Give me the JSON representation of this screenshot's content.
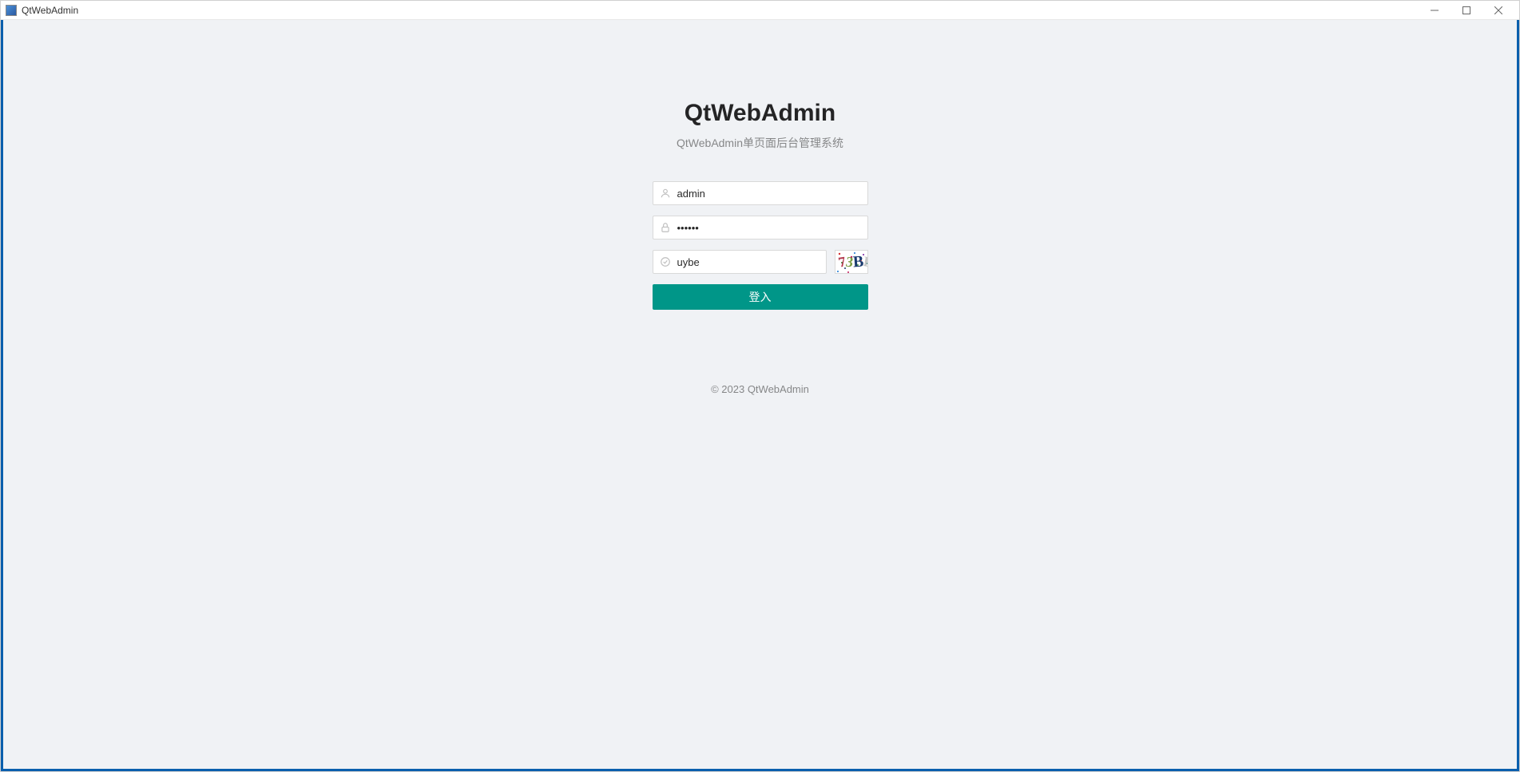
{
  "window": {
    "title": "QtWebAdmin"
  },
  "login": {
    "title": "QtWebAdmin",
    "subtitle": "QtWebAdmin单页面后台管理系统",
    "username_value": "admin",
    "password_value": "••••••",
    "captcha_value": "uybe",
    "captcha_chars": [
      "7",
      "3",
      "B",
      "E"
    ],
    "button_label": "登入"
  },
  "footer": {
    "text": "© 2023   QtWebAdmin"
  }
}
